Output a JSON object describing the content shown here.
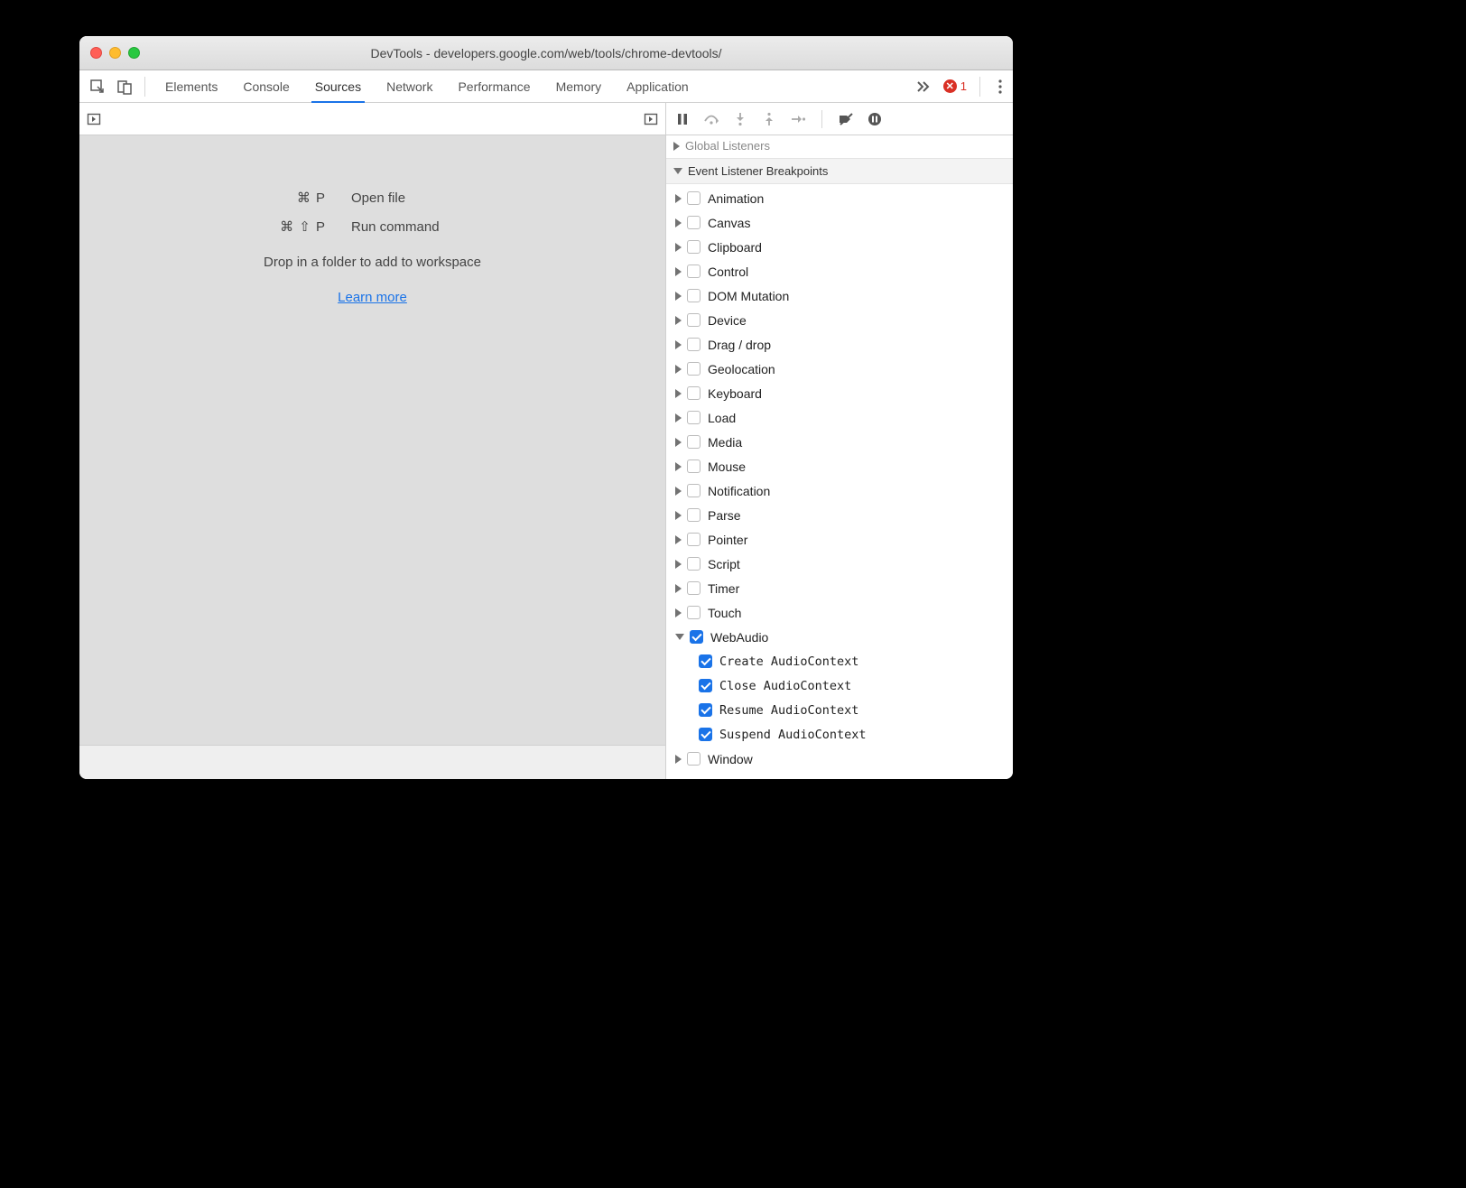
{
  "window": {
    "title": "DevTools - developers.google.com/web/tools/chrome-devtools/"
  },
  "toolbar": {
    "tabs": [
      "Elements",
      "Console",
      "Sources",
      "Network",
      "Performance",
      "Memory",
      "Application"
    ],
    "active_tab": "Sources",
    "error_count": "1"
  },
  "sources": {
    "shortcuts": [
      {
        "keys": "⌘ P",
        "label": "Open file"
      },
      {
        "keys": "⌘ ⇧ P",
        "label": "Run command"
      }
    ],
    "drop_text": "Drop in a folder to add to workspace",
    "learn_more": "Learn more"
  },
  "sidebar": {
    "global_listeners": "Global Listeners",
    "event_breakpoints_title": "Event Listener Breakpoints",
    "categories": [
      {
        "name": "Animation",
        "checked": false,
        "expanded": false
      },
      {
        "name": "Canvas",
        "checked": false,
        "expanded": false
      },
      {
        "name": "Clipboard",
        "checked": false,
        "expanded": false
      },
      {
        "name": "Control",
        "checked": false,
        "expanded": false
      },
      {
        "name": "DOM Mutation",
        "checked": false,
        "expanded": false
      },
      {
        "name": "Device",
        "checked": false,
        "expanded": false
      },
      {
        "name": "Drag / drop",
        "checked": false,
        "expanded": false
      },
      {
        "name": "Geolocation",
        "checked": false,
        "expanded": false
      },
      {
        "name": "Keyboard",
        "checked": false,
        "expanded": false
      },
      {
        "name": "Load",
        "checked": false,
        "expanded": false
      },
      {
        "name": "Media",
        "checked": false,
        "expanded": false
      },
      {
        "name": "Mouse",
        "checked": false,
        "expanded": false
      },
      {
        "name": "Notification",
        "checked": false,
        "expanded": false
      },
      {
        "name": "Parse",
        "checked": false,
        "expanded": false
      },
      {
        "name": "Pointer",
        "checked": false,
        "expanded": false
      },
      {
        "name": "Script",
        "checked": false,
        "expanded": false
      },
      {
        "name": "Timer",
        "checked": false,
        "expanded": false
      },
      {
        "name": "Touch",
        "checked": false,
        "expanded": false
      },
      {
        "name": "WebAudio",
        "checked": true,
        "expanded": true,
        "children": [
          {
            "name": "Create AudioContext",
            "checked": true
          },
          {
            "name": "Close AudioContext",
            "checked": true
          },
          {
            "name": "Resume AudioContext",
            "checked": true
          },
          {
            "name": "Suspend AudioContext",
            "checked": true
          }
        ]
      },
      {
        "name": "Window",
        "checked": false,
        "expanded": false
      }
    ]
  }
}
